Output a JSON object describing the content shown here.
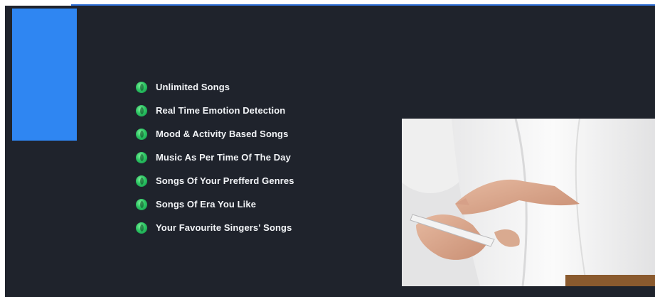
{
  "features": {
    "items": [
      {
        "label": "Unlimited Songs",
        "icon": "green-bullet-icon"
      },
      {
        "label": "Real Time Emotion Detection",
        "icon": "green-bullet-icon"
      },
      {
        "label": "Mood & Activity Based Songs",
        "icon": "green-bullet-icon"
      },
      {
        "label": "Music As Per Time Of The Day",
        "icon": "green-bullet-icon"
      },
      {
        "label": "Songs Of Your Prefferd Genres",
        "icon": "green-bullet-icon"
      },
      {
        "label": "Songs Of Era You Like",
        "icon": "green-bullet-icon"
      },
      {
        "label": "Your Favourite Singers' Songs",
        "icon": "green-bullet-icon"
      }
    ]
  },
  "colors": {
    "panel_background": "#1f232c",
    "accent_blue": "#2f86f2",
    "bullet_green": "#2cc463",
    "text": "#f2f4f7"
  }
}
